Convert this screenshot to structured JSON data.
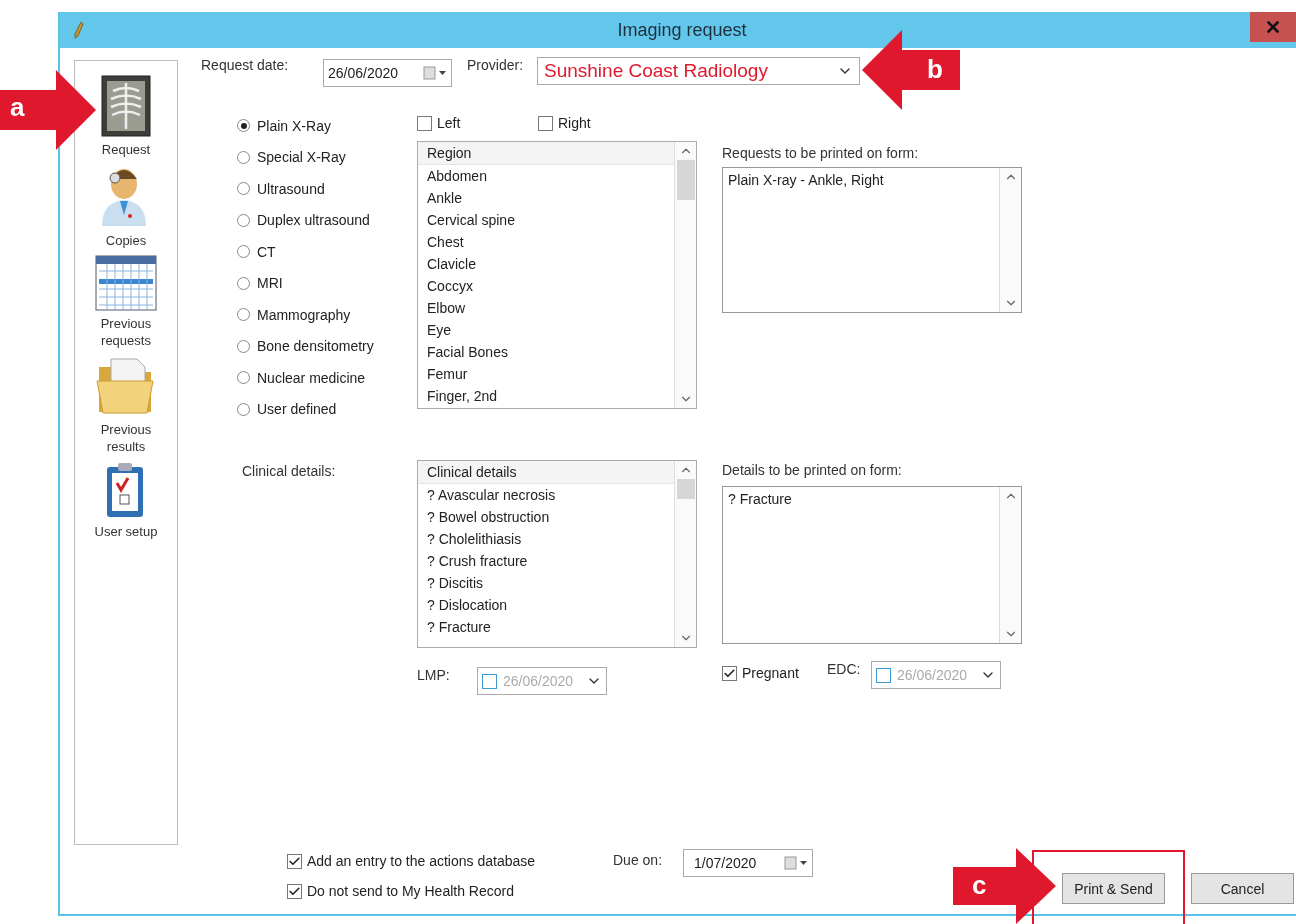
{
  "window": {
    "title": "Imaging request"
  },
  "sidebar": {
    "items": [
      {
        "label": "Request",
        "kind": "xray"
      },
      {
        "label": "Copies",
        "kind": "doctor"
      },
      {
        "label": "Previous requests",
        "kind": "calendar"
      },
      {
        "label": "Previous results",
        "kind": "folder"
      },
      {
        "label": "User setup",
        "kind": "clipboard"
      }
    ]
  },
  "request_date": {
    "label": "Request date:",
    "value": "26/06/2020"
  },
  "provider": {
    "label": "Provider:",
    "value": "Sunshine Coast Radiology"
  },
  "exam_types": [
    {
      "label": "Plain X-Ray",
      "selected": true
    },
    {
      "label": "Special X-Ray",
      "selected": false
    },
    {
      "label": "Ultrasound",
      "selected": false
    },
    {
      "label": "Duplex ultrasound",
      "selected": false
    },
    {
      "label": "CT",
      "selected": false
    },
    {
      "label": "MRI",
      "selected": false
    },
    {
      "label": "Mammography",
      "selected": false
    },
    {
      "label": "Bone densitometry",
      "selected": false
    },
    {
      "label": "Nuclear medicine",
      "selected": false
    },
    {
      "label": "User defined",
      "selected": false
    }
  ],
  "sides": [
    {
      "label": "Left",
      "checked": false
    },
    {
      "label": "Right",
      "checked": false
    }
  ],
  "region_list": {
    "header": "Region",
    "items": [
      "Abdomen",
      "Ankle",
      "Cervical spine",
      "Chest",
      "Clavicle",
      "Coccyx",
      "Elbow",
      "Eye",
      "Facial Bones",
      "Femur",
      "Finger, 2nd"
    ]
  },
  "requests_printed": {
    "label": "Requests to be printed on form:",
    "value": "Plain X-ray - Ankle, Right"
  },
  "clinical_details": {
    "label": "Clinical details:",
    "header": "Clinical details",
    "items": [
      "? Avascular necrosis",
      "? Bowel obstruction",
      "? Cholelithiasis",
      "? Crush fracture",
      "? Discitis",
      "? Dislocation",
      "? Fracture"
    ]
  },
  "details_printed": {
    "label": "Details to be printed on form:",
    "value": "? Fracture"
  },
  "lmp": {
    "label": "LMP:",
    "value": "26/06/2020",
    "checked": false
  },
  "pregnant": {
    "label": "Pregnant",
    "checked": true
  },
  "edc": {
    "label": "EDC:",
    "value": "26/06/2020",
    "checked": false
  },
  "actions": [
    {
      "label": "Add an entry to the actions database",
      "checked": true
    },
    {
      "label": "Do not send to My Health Record",
      "checked": true
    }
  ],
  "due_on": {
    "label": "Due on:",
    "value": "1/07/2020"
  },
  "buttons": [
    {
      "label": "Print & Send"
    },
    {
      "label": "Cancel"
    }
  ],
  "annotations": [
    {
      "label": "a"
    },
    {
      "label": "b"
    },
    {
      "label": "c"
    }
  ]
}
